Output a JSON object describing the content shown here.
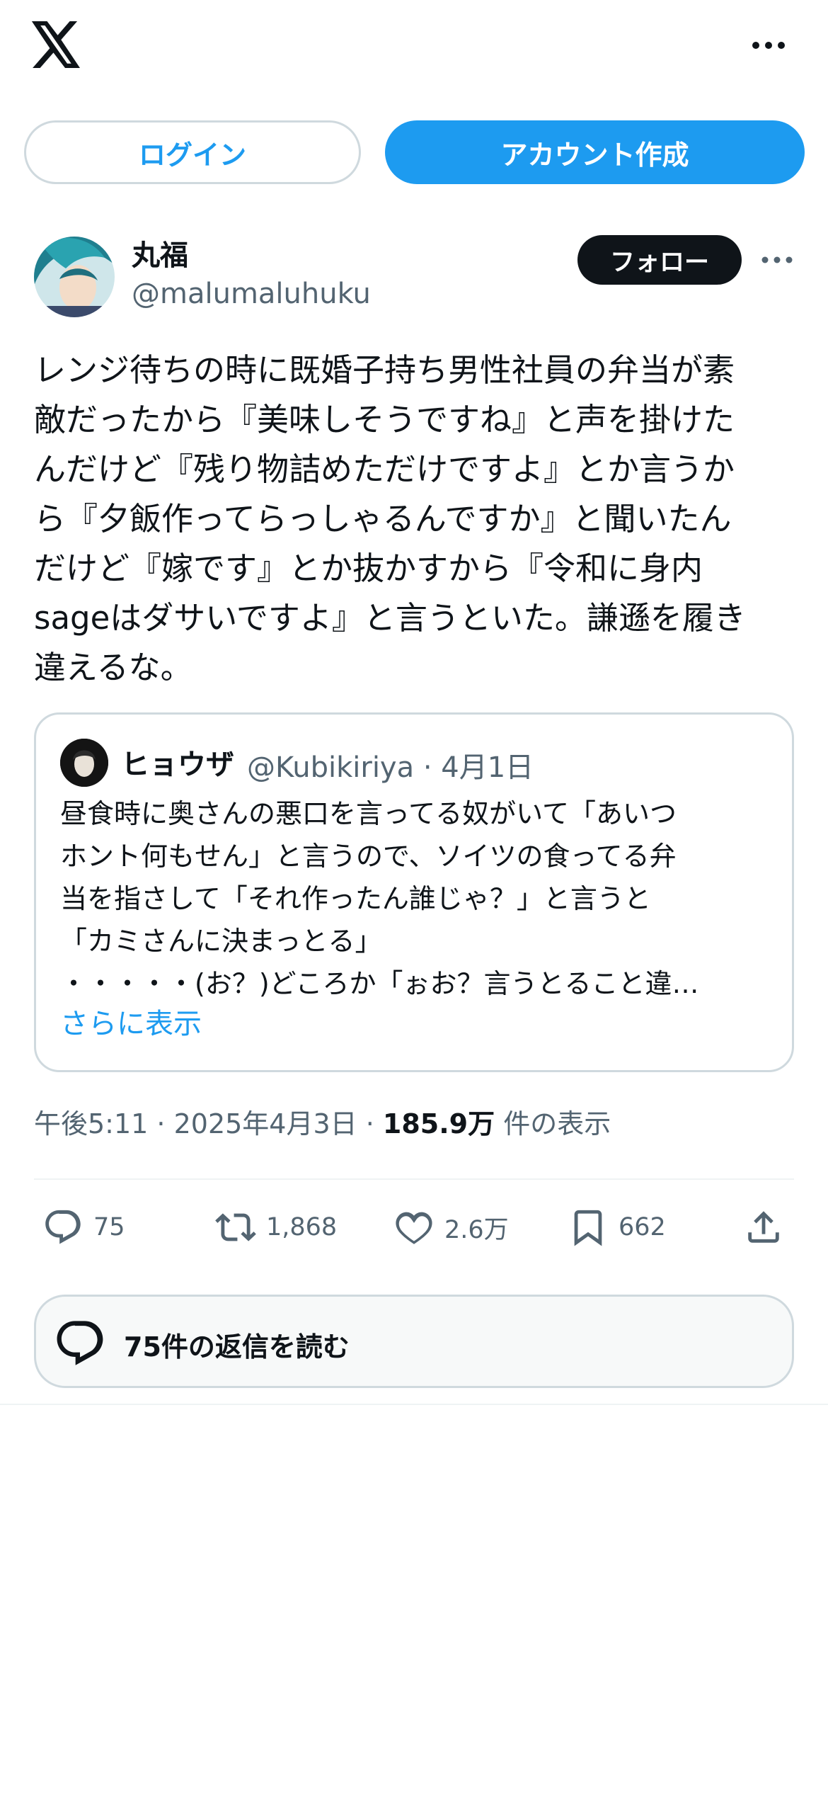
{
  "header": {
    "logo": "x-logo",
    "more_icon": "more-horizontal-icon",
    "login_label": "ログイン",
    "signup_label": "アカウント作成"
  },
  "post": {
    "author_name": "丸福",
    "author_handle": "@malumaluhuku",
    "follow_label": "フォロー",
    "text": "レンジ待ちの時に既婚子持ち男性社員の弁当が素\n敵だったから『美味しそうですね』と声を掛けた\nんだけど『残り物詰めただけですよ』とか言うか\nら『夕飯作ってらっしゃるんですか』と聞いたん\nだけど『嫁です』とか抜かすから『令和に身内\nsageはダサいですよ』と言うといた。謙遜を履き\n違えるな。",
    "quote": {
      "author_name": "ヒョウザ",
      "author_handle": "@Kubikiriya",
      "date": "4月1日",
      "text": "昼食時に奥さんの悪口を言ってる奴がいて「あいつ\nホント何もせん」と言うので、ソイツの食ってる弁\n当を指さして「それ作ったん誰じゃ？」と言うと\n「カミさんに決まっとる」\n・・・・・(お？)どころか「ぉお？言うとること違…",
      "show_more": "さらに表示"
    },
    "time": "午後5:11",
    "date": "2025年4月3日",
    "views_count": "185.9万",
    "views_label": "件の表示",
    "actions": {
      "replies": "75",
      "reposts": "1,868",
      "likes": "2.6万",
      "bookmarks": "662"
    },
    "read_replies_label": "75件の返信を読む"
  },
  "colors": {
    "accent": "#1d9bf0",
    "text": "#0f1419",
    "secondary": "#536471",
    "border": "#cfd9de"
  }
}
